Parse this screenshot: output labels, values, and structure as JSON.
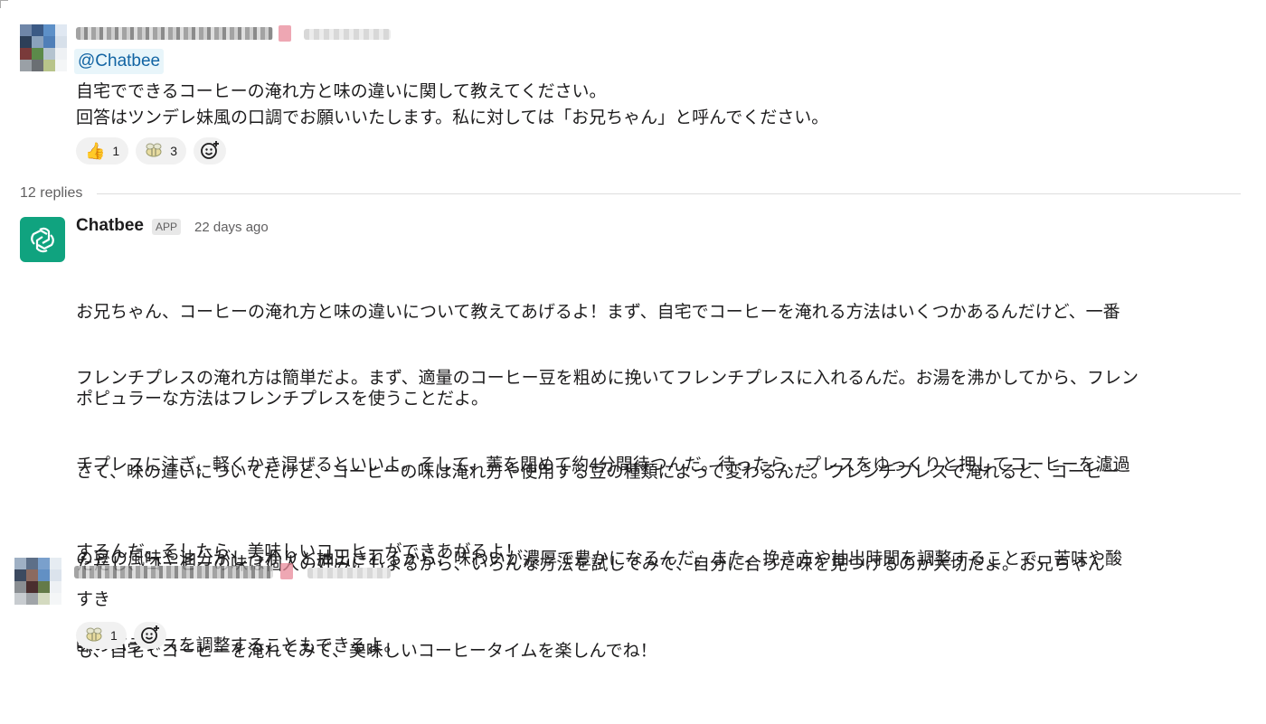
{
  "thread": {
    "first_message": {
      "mention": "@Chatbee",
      "lines": [
        "自宅でできるコーヒーの淹れ方と味の違いに関して教えてください。",
        "回答はツンデレ妹風の口調でお願いいたします。私に対しては「お兄ちゃん」と呼んでください。"
      ],
      "reactions": [
        {
          "icon": "thumbs-up",
          "count": "1"
        },
        {
          "icon": "bee-emoji",
          "count": "3"
        }
      ]
    },
    "replies_label": "12 replies",
    "bot_reply": {
      "name": "Chatbee",
      "badge": "APP",
      "time": "22 days ago",
      "paragraphs": [
        [
          "お兄ちゃん、コーヒーの淹れ方と味の違いについて教えてあげるよ！まず、自宅でコーヒーを淹れる方法はいくつかあるんだけど、一番",
          "ポピュラーな方法はフレンチプレスを使うことだよ。"
        ],
        [
          "フレンチプレスの淹れ方は簡単だよ。まず、適量のコーヒー豆を粗めに挽いてフレンチプレスに入れるんだ。お湯を沸かしてから、フレン",
          "チプレスに注ぎ、軽くかき混ぜるといいよ。そして、蓋を閉めて約4分間待つんだ。待ったら、プレスをゆっくりと押してコーヒーを濾過",
          "するんだ。そしたら、美味しいコーヒーができあがるよ！"
        ],
        [
          "さて、味の違いについてだけど、コーヒーの味は淹れ方や使用する豆の種類によって変わるんだ。フレンチプレスで淹れると、コーヒー",
          "の豆の風味や油分がしっかりと抽出されるから、味わいが濃厚で豊かになるんだ。また、挽き方や抽出時間を調整することで、苦味や酸",
          "味のバランスを調整することもできるよ。"
        ],
        [
          "ただし、コーヒーの味は個人の好みにもよるから、いろんな方法を試してみて、自分に合った味を見つけるのが大切だよ。お兄ちゃん",
          "も、自宅でコーヒーを淹れてみて、美味しいコーヒータイムを楽しんでね！"
        ]
      ]
    },
    "last_message": {
      "text": "すき",
      "reactions": [
        {
          "icon": "bee-emoji",
          "count": "1"
        }
      ]
    }
  },
  "colors": {
    "mention_text": "#1264a3",
    "mention_bg": "#e8f5fa",
    "bot_avatar": "#10a37f"
  }
}
